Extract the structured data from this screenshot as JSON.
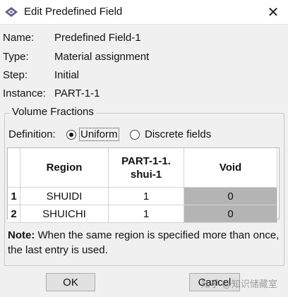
{
  "window": {
    "title": "Edit Predefined Field",
    "close_glyph": "✕"
  },
  "info": [
    {
      "label": "Name:",
      "value": "Predefined Field-1"
    },
    {
      "label": "Type:",
      "value": "Material assignment"
    },
    {
      "label": "Step:",
      "value": "Initial"
    },
    {
      "label": "Instance:",
      "value": "PART-1-1"
    }
  ],
  "volume_fractions": {
    "group_title": "Volume Fractions",
    "definition_label": "Definition:",
    "options": [
      {
        "label": "Uniform",
        "selected": true
      },
      {
        "label": "Discrete fields",
        "selected": false
      }
    ],
    "table": {
      "headers": {
        "region": "Region",
        "part_line1": "PART-1-1.",
        "part_line2": "shui-1",
        "void": "Void"
      },
      "rows": [
        {
          "num": "1",
          "region": "SHUIDI",
          "part": "1",
          "void": "0"
        },
        {
          "num": "2",
          "region": "SHUICHI",
          "part": "1",
          "void": "0"
        }
      ]
    },
    "note_label": "Note:",
    "note_text": "When the same region is specified more than once, the last entry is used."
  },
  "buttons": {
    "ok": "OK",
    "cancel": "Cancel"
  },
  "watermark": "知乎 @知识储藏室",
  "colors": {
    "void_cell": "#b4b4b4",
    "icon": "#5a5a8c"
  }
}
